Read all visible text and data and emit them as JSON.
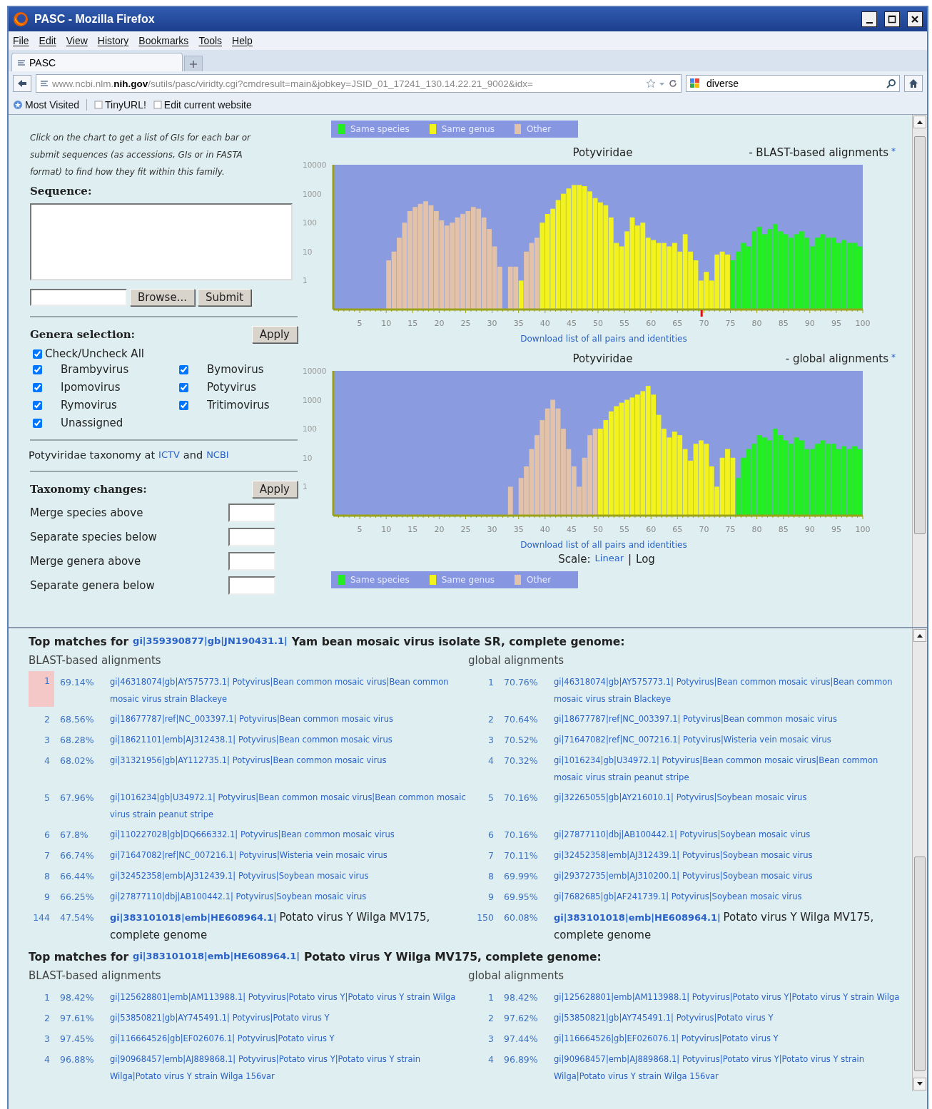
{
  "window": {
    "title": "PASC - Mozilla Firefox"
  },
  "menu": [
    "File",
    "Edit",
    "View",
    "History",
    "Bookmarks",
    "Tools",
    "Help"
  ],
  "tabs": [
    {
      "label": "PASC",
      "selected": true
    }
  ],
  "address_bar": {
    "url": "www.ncbi.nlm.**nih.gov**/sutils/pasc/viridty.cgi?cmdresult=main&jobkey=JSID_01_17241_130.14.22.21_9002&idx="
  },
  "search": {
    "value": "diverse"
  },
  "bookmarks": [
    "Most Visited",
    "TinyURL!",
    "Edit current website"
  ],
  "sidebar": {
    "instructions": "Click on the chart to get a list of GIs for each bar or submit sequences (as accessions, GIs or in FASTA format) to find how they fit within this family.",
    "sequence_label": "Sequence:",
    "browse_button": "Browse...",
    "submit_button": "Submit",
    "genera": {
      "title": "Genera selection:",
      "apply": "Apply",
      "check_all": {
        "label": "Check/Uncheck All",
        "checked": true
      },
      "items": [
        {
          "label": "Brambyvirus",
          "checked": true
        },
        {
          "label": "Bymovirus",
          "checked": true
        },
        {
          "label": "Ipomovirus",
          "checked": true
        },
        {
          "label": "Potyvirus",
          "checked": true
        },
        {
          "label": "Rymovirus",
          "checked": true
        },
        {
          "label": "Tritimovirus",
          "checked": true
        },
        {
          "label": "Unassigned",
          "checked": true
        }
      ]
    },
    "taxonomy_line": [
      {
        "kind": "text",
        "text": "Potyviridae taxonomy at"
      },
      {
        "kind": "link",
        "text": "ICTV"
      },
      {
        "kind": "text",
        "text": "and"
      },
      {
        "kind": "link",
        "text": "NCBI"
      }
    ],
    "taxonomy_changes": {
      "title": "Taxonomy changes:",
      "apply": "Apply",
      "fields": [
        {
          "label": "Merge species above"
        },
        {
          "label": "Separate species below"
        },
        {
          "label": "Merge genera above"
        },
        {
          "label": "Separate genera below"
        }
      ]
    }
  },
  "legend_top": [
    {
      "label": "Same species",
      "color": "#22ee22"
    },
    {
      "label": "Same genus",
      "color": "#f2f21e"
    },
    {
      "label": "Other",
      "color": "#e2c2a8"
    }
  ],
  "chart_panels": [
    {
      "title": "Potyviridae",
      "subtitle": "- BLAST-based alignments",
      "note": "*",
      "position_marker": true,
      "y_labels": [
        "10000",
        "1000",
        "100",
        "10",
        "1"
      ],
      "x_labels": [
        "5",
        "10",
        "15",
        "20",
        "25",
        "30",
        "35",
        "40",
        "45",
        "50",
        "55",
        "60",
        "65",
        "70",
        "75",
        "80",
        "85",
        "90",
        "95",
        "100"
      ],
      "download": "Download list of all pairs and identities"
    },
    {
      "title": "Potyviridae",
      "subtitle": "- global alignments",
      "note": "*",
      "y_labels": [
        "10000",
        "1000",
        "100",
        "10",
        "1"
      ],
      "x_labels": [
        "5",
        "10",
        "15",
        "20",
        "25",
        "30",
        "35",
        "40",
        "45",
        "50",
        "55",
        "60",
        "65",
        "70",
        "75",
        "80",
        "85",
        "90",
        "95",
        "100"
      ],
      "download": "Download list of all pairs and identities"
    }
  ],
  "scale": {
    "label": "Scale:",
    "separator": "|",
    "options": [
      {
        "label": "Linear",
        "selected": false
      },
      {
        "label": "Log",
        "selected": true
      }
    ]
  },
  "legend_bottom": [
    {
      "label": "Same species",
      "color": "#22ee22"
    },
    {
      "label": "Same genus",
      "color": "#f2f21e"
    },
    {
      "label": "Other",
      "color": "#e2c2a8"
    }
  ],
  "results": [
    {
      "heading": [
        {
          "kind": "text",
          "text": "Top matches for"
        },
        {
          "kind": "link",
          "text": "gi|359390877|gb|JN190431.1|"
        },
        {
          "kind": "text",
          "text": "Yam bean mosaic virus isolate SR, complete genome:"
        }
      ],
      "columns": [
        {
          "title": "BLAST-based alignments",
          "rows": [
            {
              "kind": "match",
              "rank": "1",
              "identity": "69.14%",
              "gi": "gi|46318074|gb|AY575773.1|",
              "description": "Potyvirus|Bean common mosaic virus|Bean common mosaic virus strain Blackeye",
              "highlighted": true
            },
            {
              "kind": "match",
              "rank": "2",
              "identity": "68.56%",
              "gi": "gi|18677787|ref|NC_003397.1|",
              "description": "Potyvirus|Bean common mosaic virus",
              "highlighted": false
            },
            {
              "kind": "match",
              "rank": "3",
              "identity": "68.28%",
              "gi": "gi|18621101|emb|AJ312438.1|",
              "description": "Potyvirus|Bean common mosaic virus",
              "highlighted": false
            },
            {
              "kind": "match",
              "rank": "4",
              "identity": "68.02%",
              "gi": "gi|31321956|gb|AY112735.1|",
              "description": "Potyvirus|Bean common mosaic virus",
              "highlighted": false
            },
            {
              "kind": "match",
              "rank": "5",
              "identity": "67.96%",
              "gi": "gi|1016234|gb|U34972.1|",
              "description": "Potyvirus|Bean common mosaic virus|Bean common mosaic virus strain peanut stripe",
              "highlighted": false
            },
            {
              "kind": "match",
              "rank": "6",
              "identity": "67.8%",
              "gi": "gi|110227028|gb|DQ666332.1|",
              "description": "Potyvirus|Bean common mosaic virus",
              "highlighted": false
            },
            {
              "kind": "match",
              "rank": "7",
              "identity": "66.74%",
              "gi": "gi|71647082|ref|NC_007216.1|",
              "description": "Potyvirus|Wisteria vein mosaic virus",
              "highlighted": false
            },
            {
              "kind": "match",
              "rank": "8",
              "identity": "66.44%",
              "gi": "gi|32452358|emb|AJ312439.1|",
              "description": "Potyvirus|Soybean mosaic virus",
              "highlighted": false
            },
            {
              "kind": "match",
              "rank": "9",
              "identity": "66.25%",
              "gi": "gi|27877110|dbj|AB100442.1|",
              "description": "Potyvirus|Soybean mosaic virus",
              "highlighted": false
            },
            {
              "kind": "query",
              "rank": "144",
              "identity": "47.54%",
              "gi": "gi|383101018|emb|HE608964.1|",
              "description": "Potato virus Y Wilga MV175, complete genome",
              "highlighted": false
            }
          ]
        },
        {
          "title": "global alignments",
          "rows": [
            {
              "kind": "match",
              "rank": "1",
              "identity": "70.76%",
              "gi": "gi|46318074|gb|AY575773.1|",
              "description": "Potyvirus|Bean common mosaic virus|Bean common mosaic virus strain Blackeye",
              "highlighted": false
            },
            {
              "kind": "match",
              "rank": "2",
              "identity": "70.64%",
              "gi": "gi|18677787|ref|NC_003397.1|",
              "description": "Potyvirus|Bean common mosaic virus",
              "highlighted": false
            },
            {
              "kind": "match",
              "rank": "3",
              "identity": "70.52%",
              "gi": "gi|71647082|ref|NC_007216.1|",
              "description": "Potyvirus|Wisteria vein mosaic virus",
              "highlighted": false
            },
            {
              "kind": "match",
              "rank": "4",
              "identity": "70.32%",
              "gi": "gi|1016234|gb|U34972.1|",
              "description": "Potyvirus|Bean common mosaic virus|Bean common mosaic virus strain peanut stripe",
              "highlighted": false
            },
            {
              "kind": "match",
              "rank": "5",
              "identity": "70.16%",
              "gi": "gi|32265055|gb|AY216010.1|",
              "description": "Potyvirus|Soybean mosaic virus",
              "highlighted": false
            },
            {
              "kind": "match",
              "rank": "6",
              "identity": "70.16%",
              "gi": "gi|27877110|dbj|AB100442.1|",
              "description": "Potyvirus|Soybean mosaic virus",
              "highlighted": false
            },
            {
              "kind": "match",
              "rank": "7",
              "identity": "70.11%",
              "gi": "gi|32452358|emb|AJ312439.1|",
              "description": "Potyvirus|Soybean mosaic virus",
              "highlighted": false
            },
            {
              "kind": "match",
              "rank": "8",
              "identity": "69.99%",
              "gi": "gi|29372735|emb|AJ310200.1|",
              "description": "Potyvirus|Soybean mosaic virus",
              "highlighted": false
            },
            {
              "kind": "match",
              "rank": "9",
              "identity": "69.95%",
              "gi": "gi|7682685|gb|AF241739.1|",
              "description": "Potyvirus|Soybean mosaic virus",
              "highlighted": false
            },
            {
              "kind": "query",
              "rank": "150",
              "identity": "60.08%",
              "gi": "gi|383101018|emb|HE608964.1|",
              "description": "Potato virus Y Wilga MV175, complete genome",
              "highlighted": false
            }
          ]
        }
      ]
    },
    {
      "heading": [
        {
          "kind": "text",
          "text": "Top matches for"
        },
        {
          "kind": "link",
          "text": "gi|383101018|emb|HE608964.1|"
        },
        {
          "kind": "text",
          "text": "Potato virus Y Wilga MV175, complete genome:"
        }
      ],
      "columns": [
        {
          "title": "BLAST-based alignments",
          "rows": [
            {
              "kind": "match",
              "rank": "1",
              "identity": "98.42%",
              "gi": "gi|125628801|emb|AM113988.1|",
              "description": "Potyvirus|Potato virus Y|Potato virus Y strain Wilga",
              "highlighted": false
            },
            {
              "kind": "match",
              "rank": "2",
              "identity": "97.61%",
              "gi": "gi|53850821|gb|AY745491.1|",
              "description": "Potyvirus|Potato virus Y",
              "highlighted": false
            },
            {
              "kind": "match",
              "rank": "3",
              "identity": "97.45%",
              "gi": "gi|116664526|gb|EF026076.1|",
              "description": "Potyvirus|Potato virus Y",
              "highlighted": false
            },
            {
              "kind": "match",
              "rank": "4",
              "identity": "96.88%",
              "gi": "gi|90968457|emb|AJ889868.1|",
              "description": "Potyvirus|Potato virus Y|Potato virus Y strain Wilga|Potato virus Y strain Wilga 156var",
              "highlighted": false
            }
          ]
        },
        {
          "title": "global alignments",
          "rows": [
            {
              "kind": "match",
              "rank": "1",
              "identity": "98.42%",
              "gi": "gi|125628801|emb|AM113988.1|",
              "description": "Potyvirus|Potato virus Y|Potato virus Y strain Wilga",
              "highlighted": false
            },
            {
              "kind": "match",
              "rank": "2",
              "identity": "97.62%",
              "gi": "gi|53850821|gb|AY745491.1|",
              "description": "Potyvirus|Potato virus Y",
              "highlighted": false
            },
            {
              "kind": "match",
              "rank": "3",
              "identity": "97.44%",
              "gi": "gi|116664526|gb|EF026076.1|",
              "description": "Potyvirus|Potato virus Y",
              "highlighted": false
            },
            {
              "kind": "match",
              "rank": "4",
              "identity": "96.89%",
              "gi": "gi|90968457|emb|AJ889868.1|",
              "description": "Potyvirus|Potato virus Y|Potato virus Y strain Wilga|Potato virus Y strain Wilga 156var",
              "highlighted": false
            }
          ]
        }
      ]
    }
  ]
}
